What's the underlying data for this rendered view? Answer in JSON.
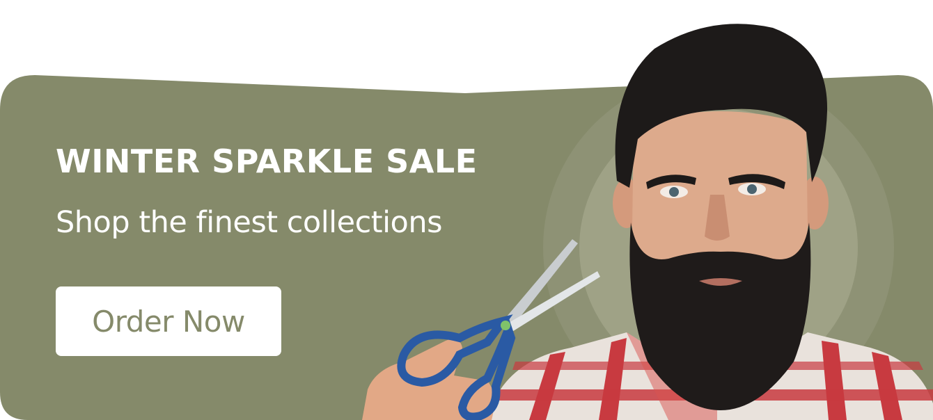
{
  "banner": {
    "headline": "WINTER SPARKLE SALE",
    "subline": "Shop the finest collections",
    "cta_label": "Order Now"
  },
  "colors": {
    "panel": "#858a6a",
    "halo": "#9fa286",
    "text": "#ffffff",
    "button_bg": "#ffffff",
    "button_text": "#858a6a"
  },
  "icons": {
    "hero": "bearded-man-with-scissors-image"
  }
}
